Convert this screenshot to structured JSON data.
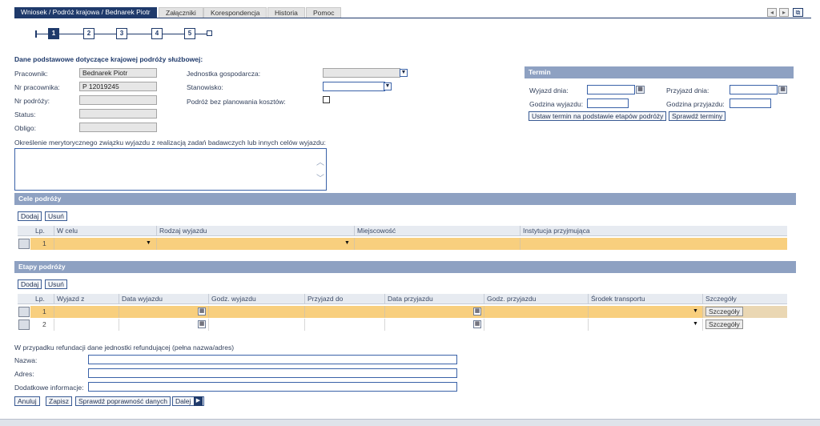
{
  "tabs": [
    {
      "label": "Wniosek / Podróż krajowa / Bednarek Piotr"
    },
    {
      "label": "Załączniki"
    },
    {
      "label": "Korespondencja"
    },
    {
      "label": "Historia"
    },
    {
      "label": "Pomoc"
    }
  ],
  "window_controls": {
    "prev": "◂",
    "next": "▸",
    "restore": "⧉"
  },
  "steps": [
    "1",
    "2",
    "3",
    "4",
    "5"
  ],
  "basic": {
    "heading": "Dane podstawowe dotyczące krajowej podróży służbowej:",
    "employee_label": "Pracownik:",
    "employee_value": "Bednarek Piotr",
    "employee_no_label": "Nr pracownika:",
    "employee_no_value": "P 12019245",
    "trip_no_label": "Nr podróży:",
    "status_label": "Status:",
    "obligo_label": "Obligo:",
    "unit_label": "Jednostka gospodarcza:",
    "position_label": "Stanowisko:",
    "no_cost_label": "Podróż bez planowania kosztów:"
  },
  "termin": {
    "title": "Termin",
    "departure_date_label": "Wyjazd dnia:",
    "arrival_date_label": "Przyjazd dnia:",
    "departure_time_label": "Godzina wyjazdu:",
    "arrival_time_label": "Godzina przyjazdu:",
    "set_button": "Ustaw termin na podstawie etapów podróży",
    "check_button": "Sprawdź terminy"
  },
  "purpose_text_label": "Określenie merytorycznego związku wyjazdu z realizacją zadań badawczych lub innych celów wyjazdu:",
  "goals": {
    "title": "Cele podróży",
    "add": "Dodaj",
    "remove": "Usuń",
    "columns": [
      "Lp.",
      "W celu",
      "Rodzaj wyjazdu",
      "Miejscowość",
      "Instytucja przyjmująca"
    ],
    "rows": [
      {
        "lp": "1"
      }
    ]
  },
  "stages": {
    "title": "Etapy podróży",
    "add": "Dodaj",
    "remove": "Usuń",
    "columns": [
      "Lp.",
      "Wyjazd z",
      "Data wyjazdu",
      "Godz. wyjazdu",
      "Przyjazd do",
      "Data przyjazdu",
      "Godz. przyjazdu",
      "Środek transportu",
      "Szczegóły"
    ],
    "rows": [
      {
        "lp": "1",
        "details": "Szczegóły"
      },
      {
        "lp": "2",
        "details": "Szczegóły"
      }
    ]
  },
  "refund": {
    "heading": "W przypadku refundacji dane jednostki refundującej (pełna nazwa/adres)",
    "name_label": "Nazwa:",
    "address_label": "Adres:",
    "extra_label": "Dodatkowe informacje:"
  },
  "actions": {
    "cancel": "Anuluj",
    "save": "Zapisz",
    "validate": "Sprawdź poprawność danych",
    "next": "Dalej"
  },
  "colors": {
    "accent": "#1f3a6b",
    "section_bar": "#8ea1c2",
    "selected_row": "#f8cf7e"
  }
}
